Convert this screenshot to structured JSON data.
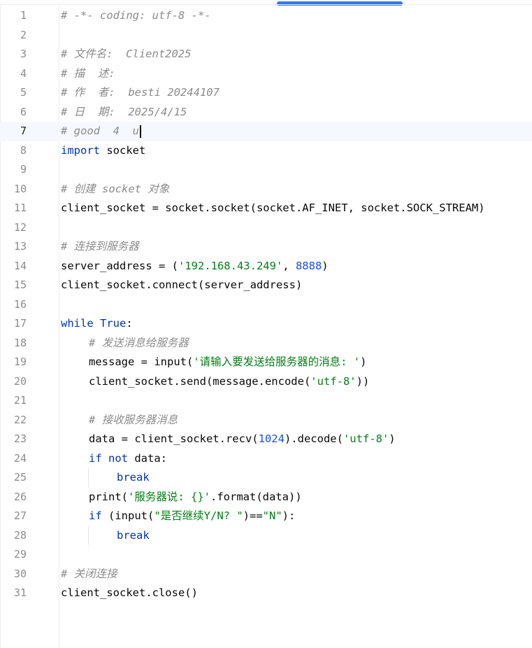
{
  "editor": {
    "language": "python",
    "current_line": 7,
    "colors": {
      "comment": "#8c8c8c",
      "keyword": "#0033b3",
      "string": "#067d17",
      "number": "#1750eb",
      "plain": "#080808",
      "current_line_bg": "#f5f8fe",
      "scrollbar": "#3574f0"
    },
    "lines": [
      {
        "n": "1",
        "indent": 0,
        "tokens": [
          [
            "c",
            "# -*- coding: utf-8 -*-"
          ]
        ]
      },
      {
        "n": "2",
        "indent": 0,
        "tokens": []
      },
      {
        "n": "3",
        "indent": 0,
        "tokens": [
          [
            "c",
            "# 文件名:  Client2025"
          ]
        ]
      },
      {
        "n": "4",
        "indent": 0,
        "tokens": [
          [
            "c",
            "# 描  述:"
          ]
        ]
      },
      {
        "n": "5",
        "indent": 0,
        "tokens": [
          [
            "c",
            "# 作  者:  besti 20244107"
          ]
        ]
      },
      {
        "n": "6",
        "indent": 0,
        "tokens": [
          [
            "c",
            "# 日  期:  2025/4/15"
          ]
        ]
      },
      {
        "n": "7",
        "indent": 0,
        "tokens": [
          [
            "c",
            "# good  4  u"
          ]
        ],
        "caret": true
      },
      {
        "n": "8",
        "indent": 0,
        "tokens": [
          [
            "k",
            "import"
          ],
          [
            "p",
            " socket"
          ]
        ]
      },
      {
        "n": "9",
        "indent": 0,
        "tokens": []
      },
      {
        "n": "10",
        "indent": 0,
        "tokens": [
          [
            "c",
            "# 创建 socket 对象"
          ]
        ]
      },
      {
        "n": "11",
        "indent": 0,
        "tokens": [
          [
            "p",
            "client_socket = socket.socket(socket.AF_INET, socket.SOCK_STREAM)"
          ]
        ]
      },
      {
        "n": "12",
        "indent": 0,
        "tokens": []
      },
      {
        "n": "13",
        "indent": 0,
        "tokens": [
          [
            "c",
            "# 连接到服务器"
          ]
        ]
      },
      {
        "n": "14",
        "indent": 0,
        "tokens": [
          [
            "p",
            "server_address = ("
          ],
          [
            "s",
            "'192.168.43.249'"
          ],
          [
            "p",
            ", "
          ],
          [
            "n",
            "8888"
          ],
          [
            "p",
            ")"
          ]
        ]
      },
      {
        "n": "15",
        "indent": 0,
        "tokens": [
          [
            "p",
            "client_socket.connect(server_address)"
          ]
        ]
      },
      {
        "n": "16",
        "indent": 0,
        "tokens": []
      },
      {
        "n": "17",
        "indent": 0,
        "tokens": [
          [
            "k",
            "while"
          ],
          [
            "p",
            " "
          ],
          [
            "k",
            "True"
          ],
          [
            "p",
            ":"
          ]
        ]
      },
      {
        "n": "18",
        "indent": 1,
        "tokens": [
          [
            "c",
            "# 发送消息给服务器"
          ]
        ]
      },
      {
        "n": "19",
        "indent": 1,
        "tokens": [
          [
            "p",
            "message = input("
          ],
          [
            "s",
            "'请输入要发送给服务器的消息: '"
          ],
          [
            "p",
            ")"
          ]
        ]
      },
      {
        "n": "20",
        "indent": 1,
        "tokens": [
          [
            "p",
            "client_socket.send(message.encode("
          ],
          [
            "s",
            "'utf-8'"
          ],
          [
            "p",
            "))"
          ]
        ]
      },
      {
        "n": "21",
        "indent": 0,
        "tokens": []
      },
      {
        "n": "22",
        "indent": 1,
        "tokens": [
          [
            "c",
            "# 接收服务器消息"
          ]
        ]
      },
      {
        "n": "23",
        "indent": 1,
        "tokens": [
          [
            "p",
            "data = client_socket.recv("
          ],
          [
            "n",
            "1024"
          ],
          [
            "p",
            ").decode("
          ],
          [
            "s",
            "'utf-8'"
          ],
          [
            "p",
            ")"
          ]
        ]
      },
      {
        "n": "24",
        "indent": 1,
        "tokens": [
          [
            "k",
            "if"
          ],
          [
            "p",
            " "
          ],
          [
            "k",
            "not"
          ],
          [
            "p",
            " data:"
          ]
        ]
      },
      {
        "n": "25",
        "indent": 2,
        "tokens": [
          [
            "k",
            "break"
          ]
        ]
      },
      {
        "n": "26",
        "indent": 1,
        "tokens": [
          [
            "p",
            "print("
          ],
          [
            "s",
            "'服务器说: {}'"
          ],
          [
            "p",
            ".format(data))"
          ]
        ]
      },
      {
        "n": "27",
        "indent": 1,
        "tokens": [
          [
            "k",
            "if"
          ],
          [
            "p",
            " (input("
          ],
          [
            "s",
            "\"是否继续Y/N? \""
          ],
          [
            "p",
            ")=="
          ],
          [
            "s",
            "\"N\""
          ],
          [
            "p",
            "):"
          ]
        ]
      },
      {
        "n": "28",
        "indent": 2,
        "tokens": [
          [
            "k",
            "break"
          ]
        ]
      },
      {
        "n": "29",
        "indent": 0,
        "tokens": []
      },
      {
        "n": "30",
        "indent": 0,
        "tokens": [
          [
            "c",
            "# 关闭连接"
          ]
        ]
      },
      {
        "n": "31",
        "indent": 0,
        "tokens": [
          [
            "p",
            "client_socket.close()"
          ]
        ]
      }
    ]
  }
}
